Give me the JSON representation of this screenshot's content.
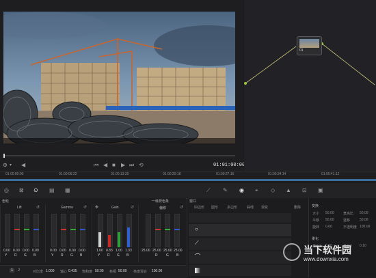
{
  "viewer": {
    "timecode": "01:01:00:00"
  },
  "node": {
    "label": "01"
  },
  "timeline": {
    "ticks": [
      "01:00:00:00",
      "01:00:06:22",
      "01:00:13:20",
      "01:00:20:18",
      "01:00:27:16",
      "01:00:34:14",
      "01:00:41:12"
    ]
  },
  "panel": {
    "mode_label": "色轮",
    "wheels": [
      {
        "name": "Lift",
        "values": [
          "0.00",
          "0.00",
          "0.00",
          "0.00"
        ],
        "sub": [
          "Y",
          "R",
          "G",
          "B"
        ]
      },
      {
        "name": "Gamma",
        "values": [
          "0.00",
          "0.00",
          "0.00",
          "0.00"
        ],
        "sub": [
          "Y",
          "R",
          "G",
          "B"
        ]
      },
      {
        "name": "Gain",
        "values": [
          "1.00",
          "0.83",
          "1.00",
          "1.33"
        ],
        "sub": [
          "Y",
          "R",
          "G",
          "B"
        ]
      },
      {
        "name": "偏移",
        "values": [
          "25.00",
          "25.00",
          "25.00",
          "25.00"
        ],
        "sub": [
          "R",
          "G",
          "B"
        ]
      }
    ],
    "mode_select": "一级校色条",
    "bottom": {
      "page": "1",
      "page2": "2",
      "contrast_label": "对比度",
      "contrast": "1.000",
      "pivot_label": "轴心",
      "pivot": "0.435",
      "sat_label": "饱和度",
      "sat": "50.00",
      "hue_label": "色相",
      "hue": "50.00",
      "lum_label": "亮度混合",
      "lum": "100.00"
    }
  },
  "window_panel": {
    "title": "窗口",
    "tools": [
      "四边形",
      "圆形",
      "多边形",
      "曲线",
      "渐变"
    ],
    "delete": "删除",
    "transform_title": "变换",
    "transform_rows": [
      {
        "a_label": "大小",
        "a": "50.00",
        "b_label": "宽高比",
        "b": "50.00"
      },
      {
        "a_label": "平移",
        "a": "50.00",
        "b_label": "竖移",
        "b": "50.00"
      },
      {
        "a_label": "旋转",
        "a": "0.00",
        "b_label": "不透明度",
        "b": "100.00"
      }
    ],
    "soft_title": "柔化",
    "soft_rows": [
      {
        "a_label": "柔化1",
        "a": "0.10",
        "b_label": "柔化2",
        "b": "0.10"
      }
    ]
  },
  "watermark": {
    "text": "当下软件园",
    "url": "www.downxia.com"
  }
}
